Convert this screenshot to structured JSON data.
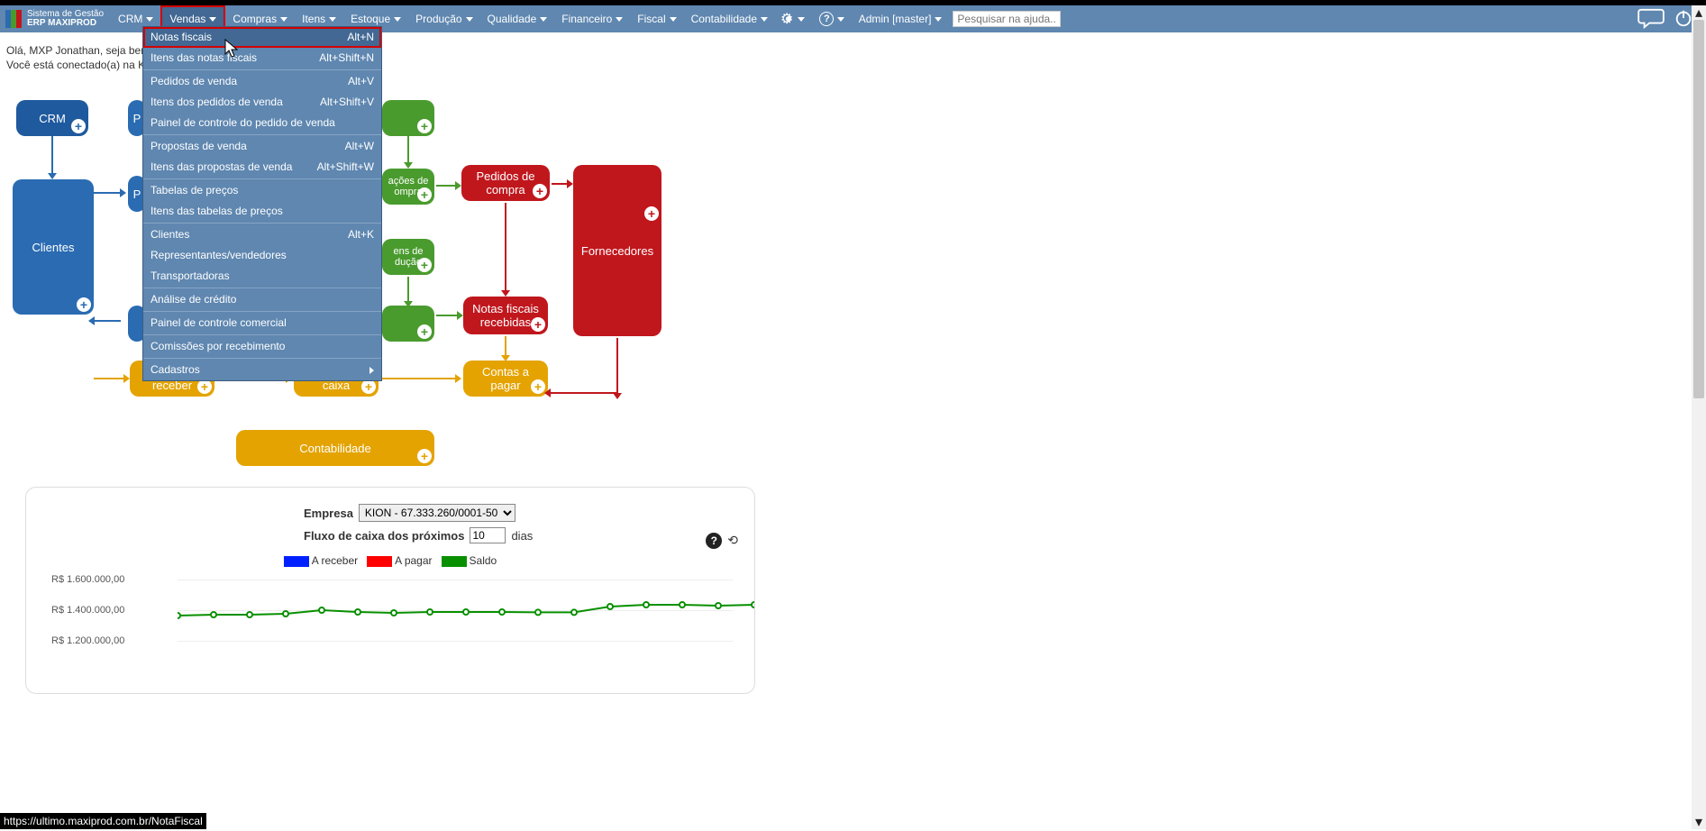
{
  "brand": {
    "line1": "Sistema de Gestão",
    "line2": "ERP MAXIPROD"
  },
  "menu": {
    "crm": "CRM",
    "vendas": "Vendas",
    "compras": "Compras",
    "itens": "Itens",
    "estoque": "Estoque",
    "producao": "Produção",
    "qualidade": "Qualidade",
    "financeiro": "Financeiro",
    "fiscal": "Fiscal",
    "contabilidade": "Contabilidade",
    "admin": "Admin [master]",
    "search_placeholder": "Pesquisar na ajuda..."
  },
  "dropdown": {
    "notas_fiscais": {
      "label": "Notas fiscais",
      "shortcut": "Alt+N"
    },
    "itens_notas": {
      "label": "Itens das notas fiscais",
      "shortcut": "Alt+Shift+N"
    },
    "pedidos_venda": {
      "label": "Pedidos de venda",
      "shortcut": "Alt+V"
    },
    "itens_pedidos_venda": {
      "label": "Itens dos pedidos de venda",
      "shortcut": "Alt+Shift+V"
    },
    "painel_pedido": {
      "label": "Painel de controle do pedido de venda",
      "shortcut": ""
    },
    "propostas": {
      "label": "Propostas de venda",
      "shortcut": "Alt+W"
    },
    "itens_propostas": {
      "label": "Itens das propostas de venda",
      "shortcut": "Alt+Shift+W"
    },
    "tabelas_precos": {
      "label": "Tabelas de preços",
      "shortcut": ""
    },
    "itens_tabelas_precos": {
      "label": "Itens das tabelas de preços",
      "shortcut": ""
    },
    "clientes": {
      "label": "Clientes",
      "shortcut": "Alt+K"
    },
    "representantes": {
      "label": "Representantes/vendedores",
      "shortcut": ""
    },
    "transportadoras": {
      "label": "Transportadoras",
      "shortcut": ""
    },
    "analise_credito": {
      "label": "Análise de crédito",
      "shortcut": ""
    },
    "painel_comercial": {
      "label": "Painel de controle comercial",
      "shortcut": ""
    },
    "comissoes": {
      "label": "Comissões por recebimento",
      "shortcut": ""
    },
    "cadastros": {
      "label": "Cadastros",
      "shortcut": ""
    }
  },
  "welcome": {
    "line1": "Olá, MXP Jonathan, seja bem-",
    "line2": "Você está conectado(a) na KI"
  },
  "flow": {
    "crm": "CRM",
    "clientes": "Clientes",
    "p": "P",
    "p2": "P",
    "acoes_compra": "ações de\nompra",
    "ens_ducao": "ens de\ndução",
    "pedidos_compra": "Pedidos de\ncompra",
    "fornecedores": "Fornecedores",
    "notas_recebidas": "Notas fiscais\nrecebidas",
    "contas_receber": "Contas a\nreceber",
    "fluxo_caixa": "Fluxo de\ncaixa",
    "contas_pagar": "Contas a\npagar",
    "contabilidade": "Contabilidade",
    "nf_block": ""
  },
  "dash": {
    "empresa_label": "Empresa",
    "empresa_value": "KION - 67.333.260/0001-50",
    "fluxo_label": "Fluxo de caixa dos próximos",
    "fluxo_value": "10",
    "fluxo_suffix": "dias",
    "legend_receber": "A receber",
    "legend_pagar": "A pagar",
    "legend_saldo": "Saldo"
  },
  "chart_data": {
    "type": "line",
    "yticks": [
      "R$ 1.600.000,00",
      "R$ 1.400.000,00",
      "R$ 1.200.000,00"
    ],
    "ylim": [
      1200000,
      1600000
    ],
    "series": [
      {
        "name": "Saldo",
        "color": "#089000",
        "values": [
          1400000,
          1405000,
          1405000,
          1410000,
          1430000,
          1420000,
          1415000,
          1420000,
          1420000,
          1420000,
          1418000,
          1418000,
          1450000,
          1460000,
          1460000,
          1455000,
          1460000
        ]
      }
    ]
  },
  "statusbar": "https://ultimo.maxiprod.com.br/NotaFiscal"
}
